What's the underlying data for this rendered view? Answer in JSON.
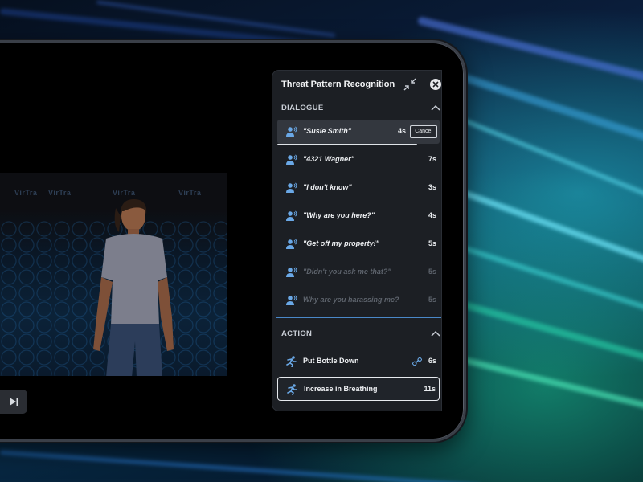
{
  "panel": {
    "title": "Threat Pattern Recognition",
    "close_icon": "close-icon",
    "collapse_icon": "collapse-icon"
  },
  "dialogue": {
    "section_label": "DIALOGUE",
    "items": [
      {
        "label": "\"Susie Smith\"",
        "duration": "4s",
        "state": "active",
        "cancel_label": "Cancel",
        "progress": 0.86
      },
      {
        "label": "\"4321 Wagner\"",
        "duration": "7s",
        "state": "normal"
      },
      {
        "label": "\"I don't know\"",
        "duration": "3s",
        "state": "normal"
      },
      {
        "label": "\"Why are you here?\"",
        "duration": "4s",
        "state": "normal"
      },
      {
        "label": "\"Get off my property!\"",
        "duration": "5s",
        "state": "normal"
      },
      {
        "label": "\"Didn't you ask me that?\"",
        "duration": "5s",
        "state": "disabled"
      },
      {
        "label": "Why are you harassing me?",
        "duration": "5s",
        "state": "disabled"
      }
    ]
  },
  "action": {
    "section_label": "ACTION",
    "items": [
      {
        "label": "Put Bottle Down",
        "duration": "6s",
        "state": "normal",
        "has_link_icon": true
      },
      {
        "label": "Increase in Breathing",
        "duration": "11s",
        "state": "outlined"
      }
    ]
  },
  "scene": {
    "wall_logo_text": "VirTra",
    "play_icon": "skip-forward-icon"
  },
  "colors": {
    "panel_bg": "#1c1f24",
    "accent_blue": "#4a88c8",
    "icon_blue": "#6aa8e6"
  }
}
